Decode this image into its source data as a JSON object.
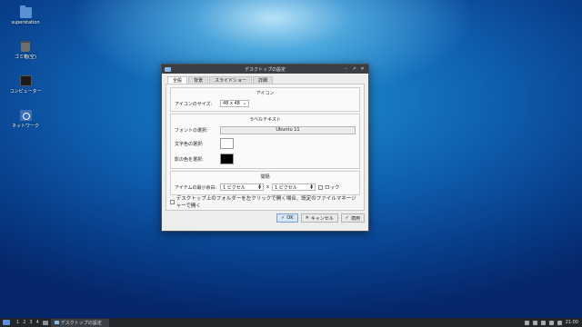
{
  "desktop": {
    "icons": [
      {
        "label": "superstation"
      },
      {
        "label": "ゴミ箱(空)"
      },
      {
        "label": "コンピューター"
      },
      {
        "label": "ネットワーク"
      }
    ]
  },
  "window": {
    "title": "デスクトップの設定",
    "tabs": [
      "全般",
      "背景",
      "スライドショー",
      "詳細"
    ],
    "icon_section": {
      "title": "アイコン",
      "size_label": "アイコンのサイズ:",
      "size_value": "48 x 48"
    },
    "label_section": {
      "title": "ラベルテキスト",
      "font_label": "フォントの選択:",
      "font_value": "Ubuntu 11",
      "text_color_label": "文字色の選択:",
      "text_color": "#ffffff",
      "shadow_color_label": "影の色を選択:",
      "shadow_color": "#000000"
    },
    "spacing_section": {
      "title": "間隔",
      "min_spacing_label": "アイテムの最小余白:",
      "x_value": "1 ピクセル",
      "times": "x",
      "y_value": "1 ピクセル",
      "lock_label": "ロック",
      "lock_checked": false
    },
    "folder_option": {
      "label": "デスクトップ上のフォルダーを左クリックで開く場合、既定のファイルマネージャーで開く",
      "checked": false
    },
    "buttons": {
      "ok": "OK",
      "cancel": "キャンセル",
      "apply": "適用"
    }
  },
  "taskbar": {
    "workspaces": [
      "1",
      "2",
      "3",
      "4"
    ],
    "task_label": "デスクトップの設定",
    "clock": "21:00"
  }
}
